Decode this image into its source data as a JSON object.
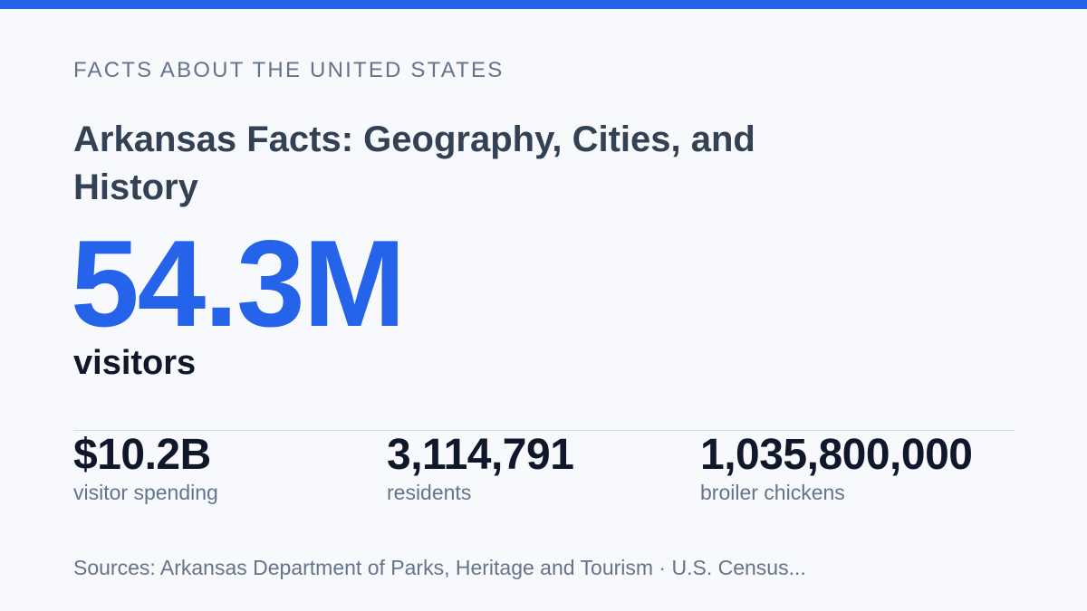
{
  "eyebrow": "FACTS ABOUT THE UNITED STATES",
  "title": "Arkansas Facts: Geography, Cities, and History",
  "hero": {
    "value": "54.3M",
    "label": "visitors"
  },
  "stats": [
    {
      "value": "$10.2B",
      "label": "visitor spending"
    },
    {
      "value": "3,114,791",
      "label": "residents"
    },
    {
      "value": "1,035,800,000",
      "label": "broiler chickens"
    }
  ],
  "sources": "Sources: Arkansas Department of Parks, Heritage and Tourism · U.S. Census...",
  "colors": {
    "accent": "#2563eb",
    "background": "#f7f9fc",
    "text_dark": "#0f172a",
    "text_muted": "#64748b"
  }
}
